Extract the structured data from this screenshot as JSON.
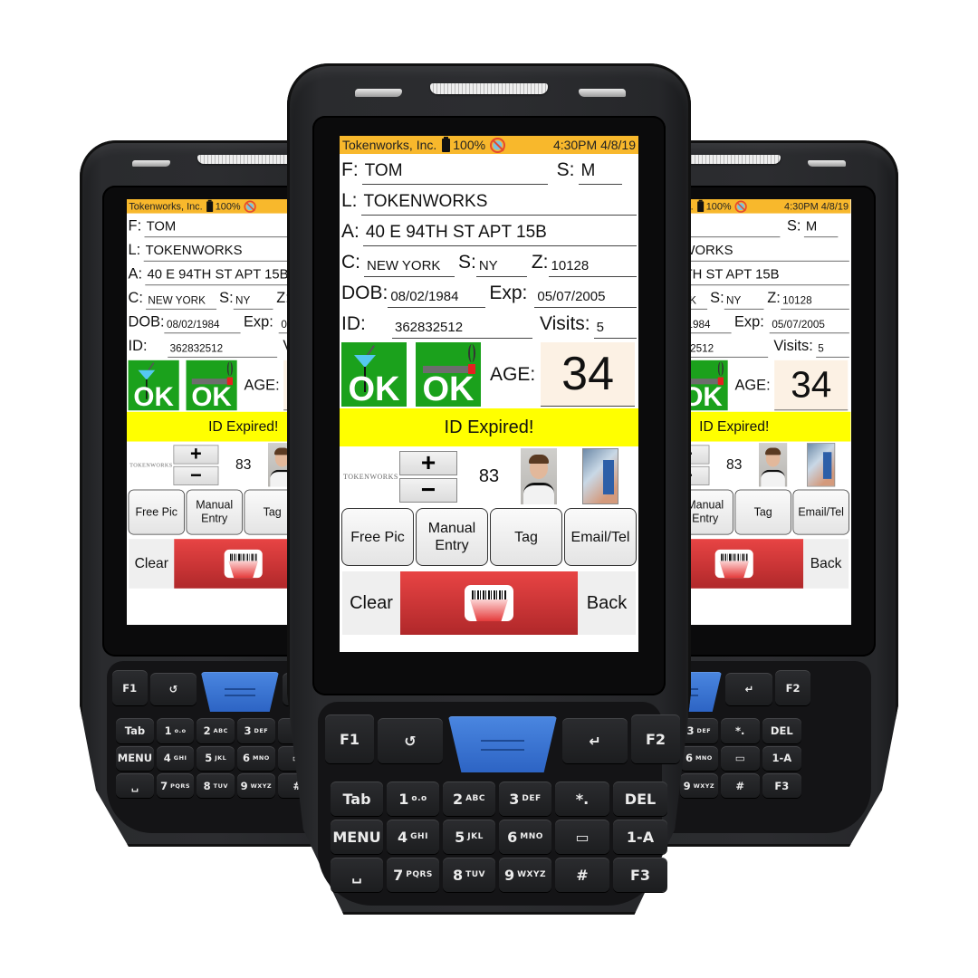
{
  "app": {
    "status_bar": {
      "company": "Tokenworks, Inc.",
      "battery": "100%",
      "battery_icon": "battery-icon",
      "sync_icon": "no-sync-icon",
      "time": "4:30PM 4/8/19"
    },
    "fields": {
      "first_name": {
        "label": "F:",
        "value": "TOM"
      },
      "sex": {
        "label": "S:",
        "value": "M"
      },
      "last_name": {
        "label": "L:",
        "value": "TOKENWORKS"
      },
      "address": {
        "label": "A:",
        "value": "40 E 94TH ST APT 15B"
      },
      "city": {
        "label": "C:",
        "value": "NEW YORK"
      },
      "state": {
        "label": "S:",
        "value": "NY"
      },
      "zip": {
        "label": "Z:",
        "value": "10128"
      },
      "dob": {
        "label": "DOB:",
        "value": "08/02/1984"
      },
      "exp": {
        "label": "Exp:",
        "value": "05/07/2005"
      },
      "id": {
        "label": "ID:",
        "value": "362832512"
      },
      "visits": {
        "label": "Visits:",
        "value": "5"
      }
    },
    "badges": {
      "alcohol": {
        "text": "OK",
        "icon": "martini-icon",
        "color": "#1ba11c"
      },
      "tobacco": {
        "text": "OK",
        "icon": "cigarette-icon",
        "color": "#1ba11c"
      }
    },
    "age": {
      "label": "AGE:",
      "value": "34"
    },
    "alert": {
      "text": "ID Expired!",
      "color": "#ffff00"
    },
    "logo_text": "TOKENWORKS",
    "stepper": {
      "plus": "+",
      "minus": "−",
      "count": "83"
    },
    "images": {
      "portrait": "portrait-photo",
      "license": "license-photo"
    },
    "actions": [
      "Free Pic",
      "Manual Entry",
      "Tag",
      "Email/Tel"
    ],
    "bottom": {
      "clear": "Clear",
      "scan_icon": "barcode-scan-icon",
      "back": "Back"
    }
  },
  "keypad": {
    "row1": [
      "F1",
      "↺",
      "",
      "↵",
      "F2"
    ],
    "row2": [
      {
        "main": "Tab",
        "sub": ""
      },
      {
        "main": "1",
        "sub": "o.o"
      },
      {
        "main": "2",
        "sub": "ABC"
      },
      {
        "main": "3",
        "sub": "DEF"
      },
      {
        "main": "*.",
        "sub": ""
      },
      {
        "main": "DEL",
        "sub": ""
      }
    ],
    "row3": [
      {
        "main": "MENU",
        "sub": ""
      },
      {
        "main": "4",
        "sub": "GHI"
      },
      {
        "main": "5",
        "sub": "JKL"
      },
      {
        "main": "6",
        "sub": "MNO"
      },
      {
        "main": "▭",
        "sub": ""
      },
      {
        "main": "1-A",
        "sub": ""
      }
    ],
    "row4": [
      {
        "main": "␣",
        "sub": ""
      },
      {
        "main": "7",
        "sub": "PQRS"
      },
      {
        "main": "8",
        "sub": "TUV"
      },
      {
        "main": "9",
        "sub": "WXYZ"
      },
      {
        "main": "#",
        "sub": ""
      },
      {
        "main": "F3",
        "sub": ""
      }
    ]
  },
  "colors": {
    "status_bar": "#f8b82c",
    "ok_green": "#1ba11c",
    "alert_yellow": "#ffff00",
    "scan_red": "#d43434",
    "blue_key": "#3a74d4",
    "age_bg": "#fcf1e4"
  }
}
